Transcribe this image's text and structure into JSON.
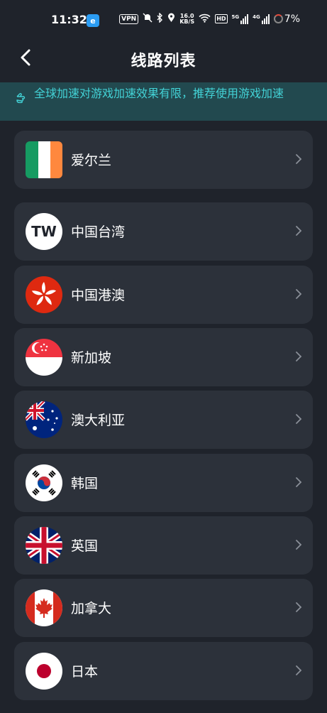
{
  "status_bar": {
    "time": "11:32",
    "app_badge": "e",
    "vpn": "VPN",
    "net_speed_value": "16.0",
    "net_speed_unit": "KB/S",
    "hd": "HD",
    "sig1_label": "5G",
    "sig2_label": "4G",
    "battery": "7%"
  },
  "header": {
    "title": "线路列表"
  },
  "notice": {
    "text": "全球加速对游戏加速效果有限，推荐使用游戏加速",
    "icon": "pointing-hand-icon"
  },
  "regions": [
    {
      "label": "爱尔兰",
      "flag": "ireland"
    },
    {
      "label": "中国台湾",
      "flag": "tw-text"
    },
    {
      "label": "中国港澳",
      "flag": "hong-kong"
    },
    {
      "label": "新加坡",
      "flag": "singapore"
    },
    {
      "label": "澳大利亚",
      "flag": "australia"
    },
    {
      "label": "韩国",
      "flag": "korea"
    },
    {
      "label": "英国",
      "flag": "uk"
    },
    {
      "label": "加拿大",
      "flag": "canada"
    },
    {
      "label": "日本",
      "flag": "japan"
    }
  ],
  "tw_flag_text": "TW",
  "colors": {
    "background": "#1f232b",
    "card": "#2c313a",
    "notice_bg": "#22494f",
    "notice_text": "#43d2d6"
  }
}
